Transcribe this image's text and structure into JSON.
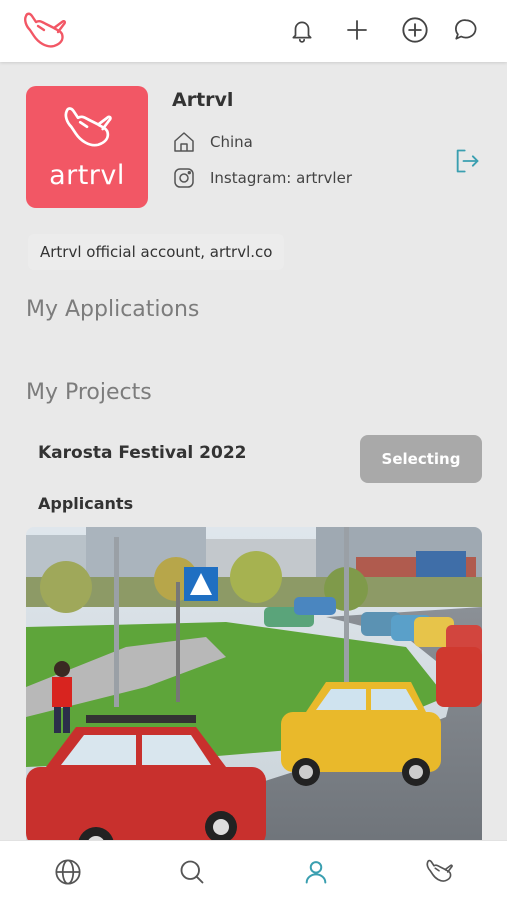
{
  "header": {
    "logo_icon": "shaka-hand-icon",
    "icons": [
      "bell-icon",
      "plus-icon",
      "plus-circle-icon",
      "chat-bubble-icon"
    ]
  },
  "profile": {
    "avatar_text": "artrvl",
    "name": "Artrvl",
    "location": "China",
    "instagram": "Instagram: artrvler",
    "bio": "Artrvl official account, artrvl.co"
  },
  "sections": {
    "applications_title": "My Applications",
    "projects_title": "My Projects"
  },
  "project": {
    "name": "Karosta Festival 2022",
    "status_button": "Selecting",
    "applicants_label": "Applicants"
  },
  "bottom_nav": {
    "items": [
      "globe-icon",
      "search-icon",
      "profile-icon",
      "shaka-hand-icon"
    ],
    "active": "profile-icon"
  },
  "colors": {
    "brand": "#f25765",
    "accent": "#3a9fb0",
    "button_gray": "#a9a9a9",
    "background": "#e9e9e9"
  }
}
